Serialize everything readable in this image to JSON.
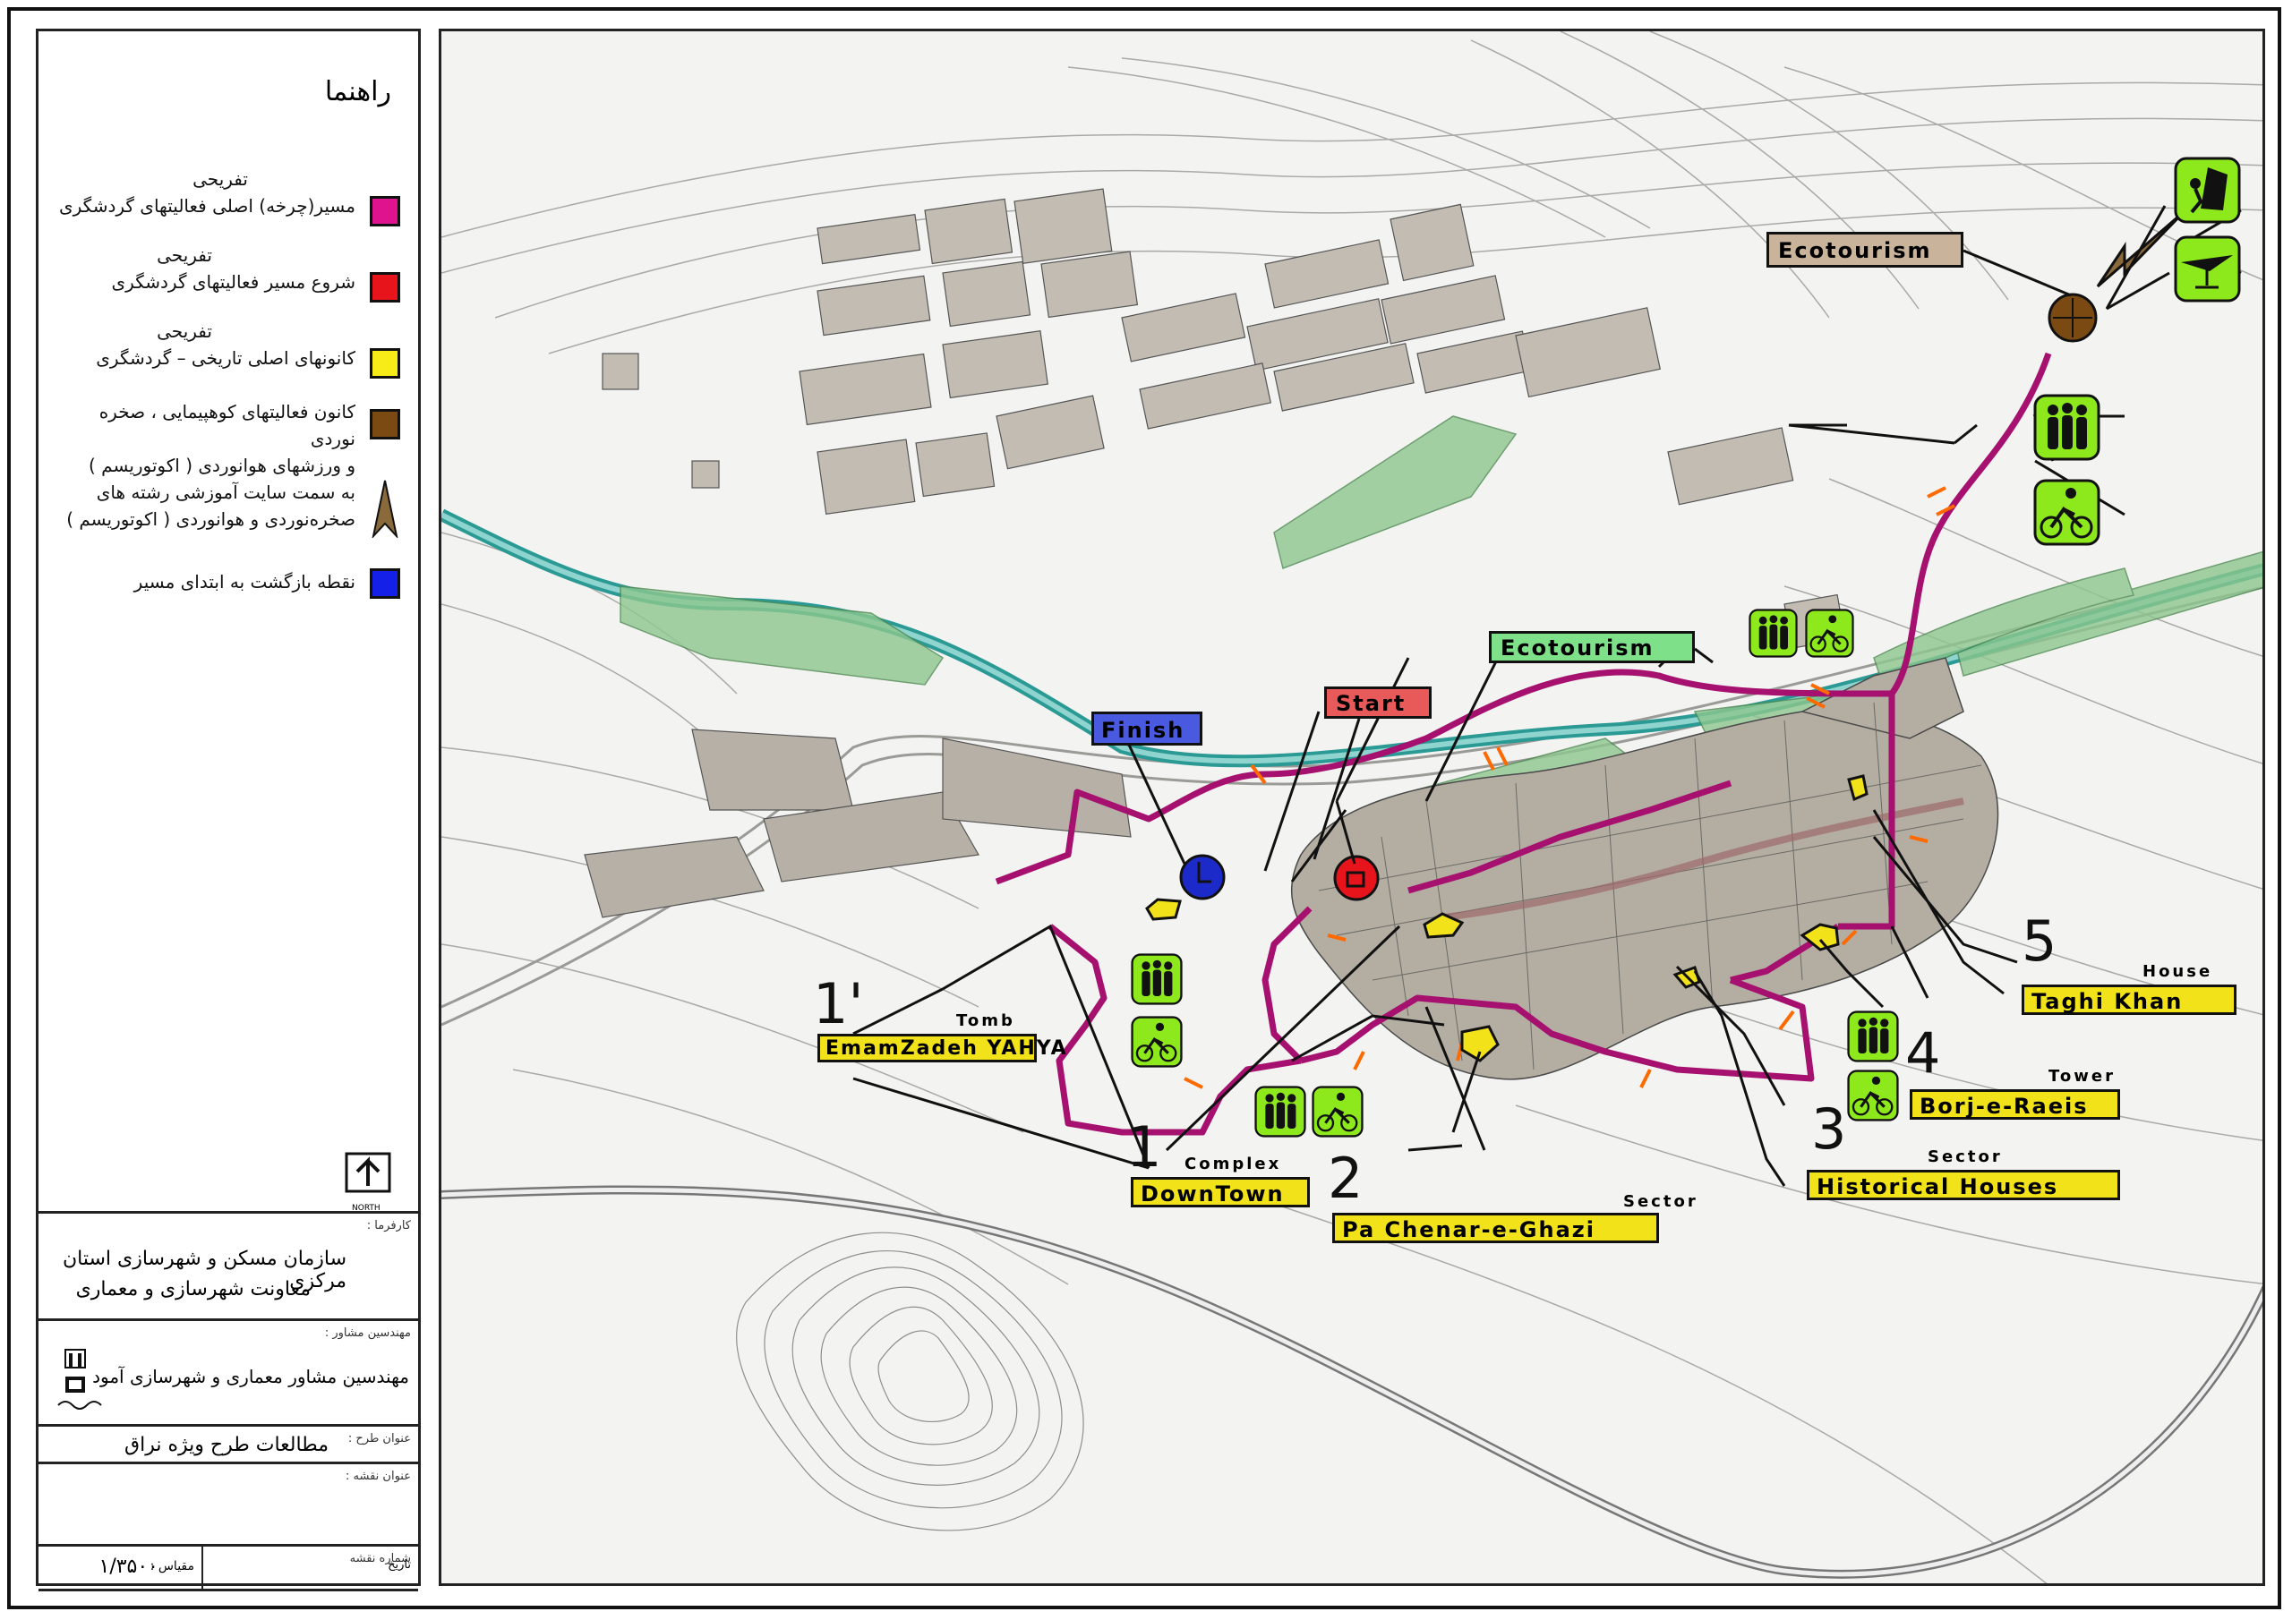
{
  "legend": {
    "title": "راهنما",
    "items": [
      {
        "line1": "تفریحی",
        "line2": "مسیر(چرخه) اصلی فعالیتهای گردشگری",
        "color": "#e0138f"
      },
      {
        "line1": "تفریحی",
        "line2": "شروع مسیر فعالیتهای گردشگری",
        "color": "#e8141c"
      },
      {
        "line1": "تفریحی",
        "line2": "کانونهای اصلی تاریخی – گردشگری",
        "color": "#f7ec18"
      },
      {
        "line1": "کانون فعالیتهای کوهپیمایی ، صخره نوردی",
        "line2": "و ورزشهای هوانوردی ( اکوتوریسم )",
        "color": "#7a4a12"
      },
      {
        "line1": "به سمت سایت آموزشی رشته های",
        "line2": "صخره‌نوردی و هوانوردی ( اکوتوریسم )",
        "color": "#8a6a3a"
      },
      {
        "line1": "",
        "line2": "نقطه بازگشت به ابتدای مسیر",
        "color": "#1420e8"
      }
    ],
    "north": "NORTH"
  },
  "title_block": {
    "client_label": "کارفرما :",
    "client_line1": "سازمان مسکن و شهرسازی استان مرکزی",
    "client_line2": "معاونت شهرسازی و معماری",
    "consultant_label": "مهندسین مشاور :",
    "consultant_name": "مهندسین مشاور معماری و شهرسازی آمود",
    "project_label": "عنوان طرح :",
    "project_name": "مطالعات طرح ویژه نراق",
    "map_title_label": "عنوان نقشه :",
    "map_number_label": "شماره نقشه",
    "scale_label": "مقیاس :",
    "scale_value": "۱/۳۵۰۰",
    "date_label": "تاریخ"
  },
  "map_labels": {
    "start": "Start",
    "finish": "Finish",
    "ecotourism_top": "Ecotourism",
    "ecotourism_mid": "Ecotourism",
    "sites": [
      {
        "num": "1'",
        "small": "Tomb",
        "big": "EmamZadeh YAHYA"
      },
      {
        "num": "1",
        "small": "Complex",
        "big": "DownTown"
      },
      {
        "num": "2",
        "small": "Sector",
        "big": "Pa Chenar-e-Ghazi"
      },
      {
        "num": "3",
        "small": "Sector",
        "big": "Historical Houses"
      },
      {
        "num": "4",
        "small": "Tower",
        "big": "Borj-e-Raeis"
      },
      {
        "num": "5",
        "small": "House",
        "big": "Taghi Khan"
      }
    ]
  },
  "colors": {
    "route": "#b0137a",
    "start": "#e8141c",
    "finish": "#1c2ac9",
    "poi": "#f2e21a",
    "eco": "#7fe08a",
    "icon_bg": "#8de81c",
    "buildings": "#b9b3aa"
  }
}
